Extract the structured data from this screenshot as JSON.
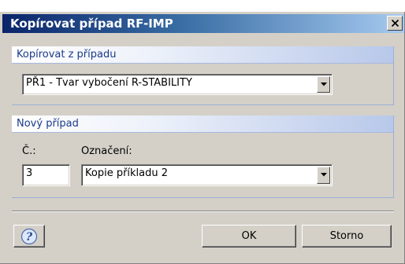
{
  "window": {
    "title": "Kopírovat případ RF-IMP",
    "close_glyph": "×"
  },
  "copy_from_group": {
    "heading": "Kopírovat z případu",
    "selected_value": "PŘ1 - Tvar vybočení R-STABILITY"
  },
  "new_case_group": {
    "heading": "Nový případ",
    "number_label": "Č.:",
    "number_value": "3",
    "designation_label": "Označení:",
    "designation_value": "Kopie příkladu 2"
  },
  "buttons": {
    "help_icon": "help-question-icon",
    "ok_label": "OK",
    "cancel_label": "Storno"
  },
  "colors": {
    "title_gradient_start": "#0a246a",
    "title_gradient_end": "#a6caf0",
    "dialog_bg": "#d4d0c8",
    "group_heading_text": "#1a3a8a"
  }
}
